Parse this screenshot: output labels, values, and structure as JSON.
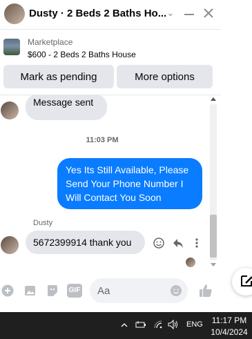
{
  "header": {
    "title": "Dusty · 2 Beds 2 Baths Ho..."
  },
  "listing": {
    "source": "Marketplace",
    "price_line": "$600 - 2 Beds 2 Baths House",
    "mark_pending_label": "Mark as pending",
    "more_options_label": "More options"
  },
  "thread": {
    "msg1": "Message sent",
    "timestamp": "11:03 PM",
    "outgoing": "Yes Its Still Available, Please Send Your Phone Number I Will Contact You Soon",
    "sender_name": "Dusty",
    "incoming": "5672399914 thank you"
  },
  "composer": {
    "placeholder": "Aa"
  },
  "taskbar": {
    "lang": "ENG",
    "time": "11:17 PM",
    "date": "10/4/2024"
  },
  "colors": {
    "accent": "#0a7cff",
    "bubble_in": "#e4e6eb",
    "taskbar": "#1f1f1f"
  }
}
